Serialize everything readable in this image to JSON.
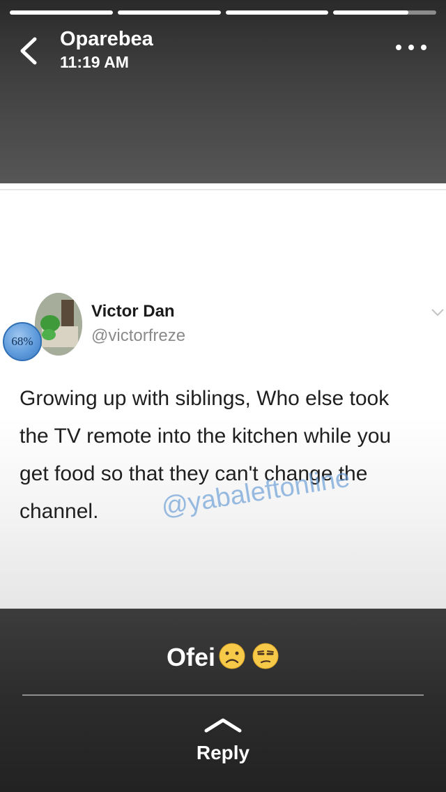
{
  "story": {
    "author": "Oparebea",
    "time": "11:19 AM",
    "segments": 4,
    "active_segment_progress": 0.73
  },
  "tweet": {
    "badge": "68%",
    "name": "Victor Dan",
    "handle": "@victorfreze",
    "text": "Growing up with siblings, Who else took\nthe TV remote into the kitchen while you\nget food so that they can't change the\nchannel.",
    "watermark": "@yabaleftonline"
  },
  "caption": {
    "text": "Ofei",
    "emojis": [
      "frowning-face-emoji",
      "unamused-face-emoji"
    ]
  },
  "reply": {
    "label": "Reply"
  },
  "colors": {
    "accent_badge": "#5f9bdc",
    "emoji": "#f7c948"
  }
}
